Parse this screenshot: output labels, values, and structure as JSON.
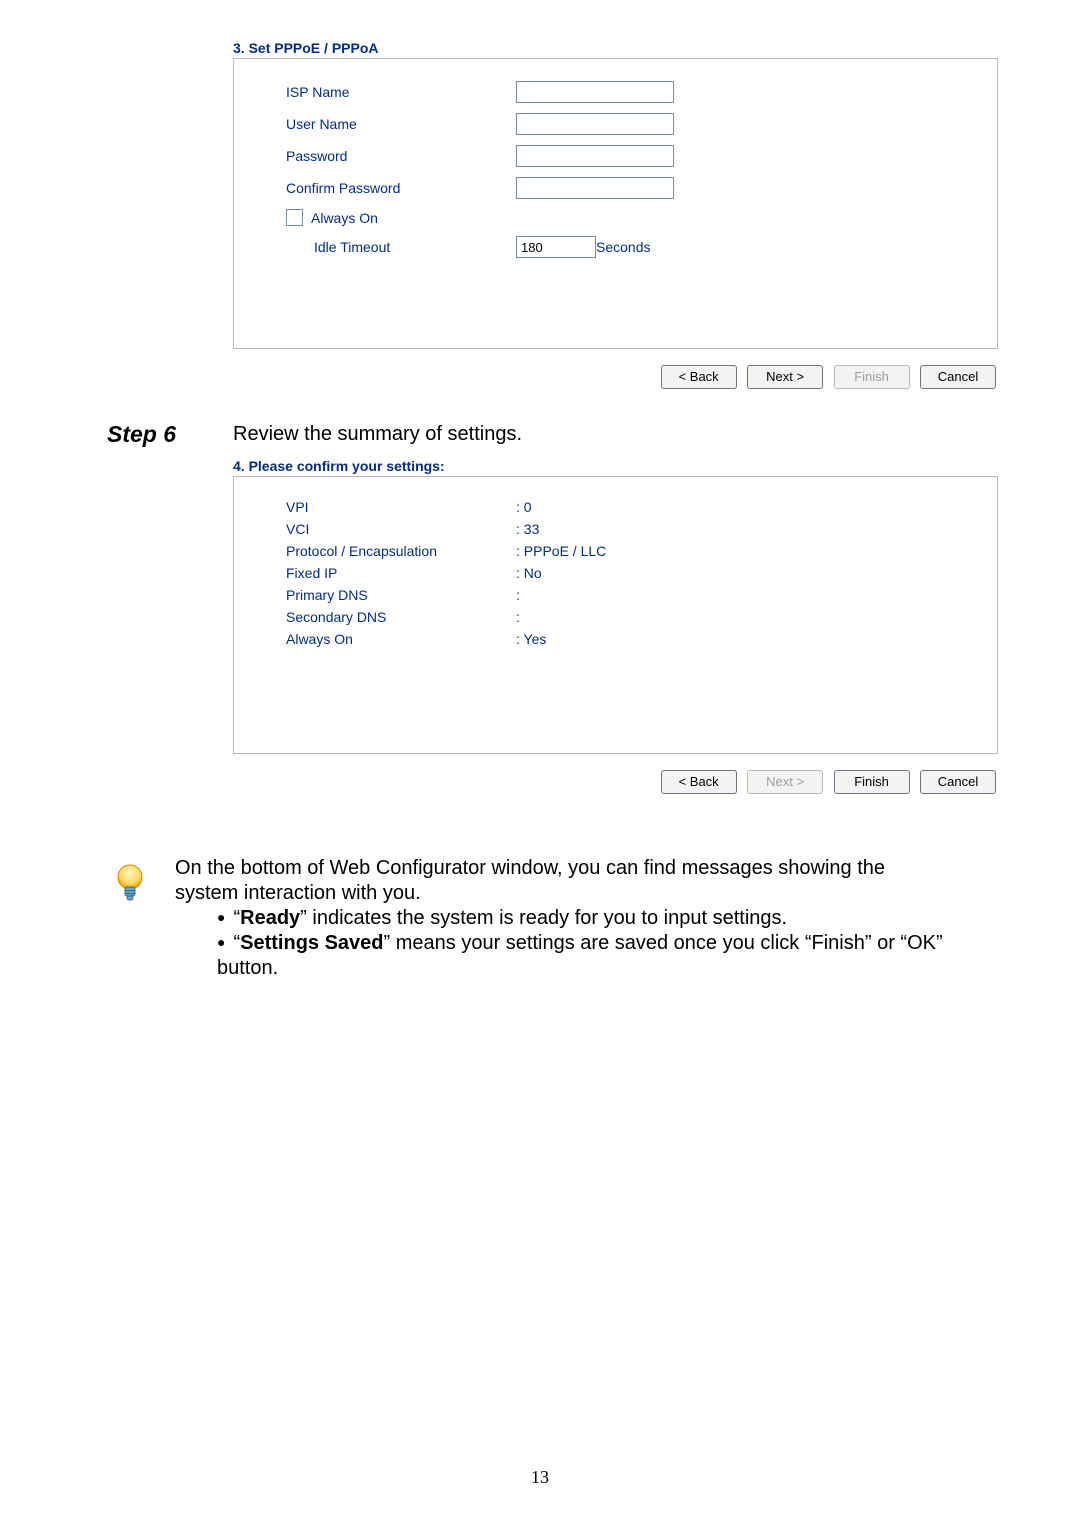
{
  "panel3": {
    "title": "3. Set PPPoE / PPPoA",
    "fields": {
      "isp_name_label": "ISP Name",
      "isp_name_value": "",
      "user_name_label": "User Name",
      "user_name_value": "",
      "password_label": "Password",
      "password_value": "",
      "confirm_password_label": "Confirm Password",
      "confirm_password_value": "",
      "always_on_label": "Always On",
      "idle_timeout_label": "Idle Timeout",
      "idle_timeout_value": "180",
      "seconds_label": "Seconds"
    },
    "buttons": {
      "back": "< Back",
      "next": "Next >",
      "finish": "Finish",
      "cancel": "Cancel"
    }
  },
  "step6": {
    "label": "Step 6",
    "text": "Review the summary of settings."
  },
  "panel4": {
    "title": "4. Please confirm your settings:",
    "rows": [
      {
        "label": "VPI",
        "value": ":  0"
      },
      {
        "label": "VCI",
        "value": ":  33"
      },
      {
        "label": "Protocol / Encapsulation",
        "value": ":  PPPoE / LLC"
      },
      {
        "label": "Fixed IP",
        "value": ":  No"
      },
      {
        "label": "Primary DNS",
        "value": ":"
      },
      {
        "label": "Secondary DNS",
        "value": ":"
      },
      {
        "label": "Always On",
        "value": ":  Yes"
      }
    ],
    "buttons": {
      "back": "< Back",
      "next": "Next >",
      "finish": "Finish",
      "cancel": "Cancel"
    }
  },
  "chart_data": {
    "type": "table",
    "title": "4. Please confirm your settings:",
    "categories": [
      "VPI",
      "VCI",
      "Protocol / Encapsulation",
      "Fixed IP",
      "Primary DNS",
      "Secondary DNS",
      "Always On"
    ],
    "values": [
      "0",
      "33",
      "PPPoE / LLC",
      "No",
      "",
      "",
      "Yes"
    ]
  },
  "tip": {
    "intro": "On the bottom of Web Configurator window, you can find messages showing the system interaction with you.",
    "bullet1_prefix": "“",
    "bullet1_bold": "Ready",
    "bullet1_suffix": "” indicates the system is ready for you to input settings.",
    "bullet2_prefix": "“",
    "bullet2_bold": "Settings Saved",
    "bullet2_suffix": "” means your settings are saved once you click “Finish” or “OK” button."
  },
  "page_number": "13"
}
